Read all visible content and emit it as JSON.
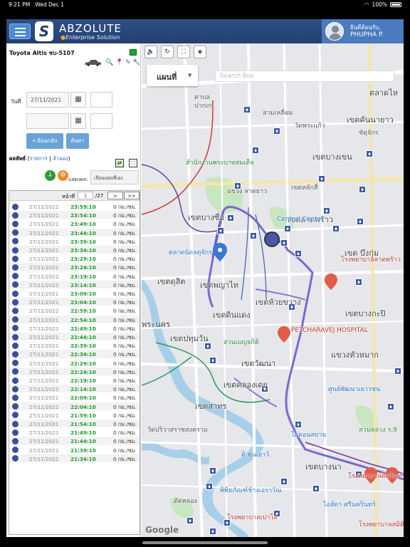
{
  "status_bar": {
    "time": "9:21 PM",
    "date": "Wed Dec 1",
    "battery": "100%"
  },
  "header": {
    "brand": "ABZOLUTE",
    "brand_sub": "Enterprise Solution",
    "greeting": "ยินดีต้อนรับ,",
    "user_name": "PHUPHA P."
  },
  "vehicle": {
    "name": "Toyota Altis ชบ-5107",
    "status_color": "#1aa830"
  },
  "filters": {
    "date_label": "วันที่",
    "date_from": "27/11/2021",
    "date_to": "",
    "back_button": "« ย้อนกลับ",
    "search_button": "ค้นหา"
  },
  "results": {
    "label": "ผลลัพธ์",
    "list_link": "รายการ",
    "separator": "|",
    "sim_link": "จำลอง",
    "show_label": "แสดงผล:",
    "show_select": "เลือนแผนที่เอง"
  },
  "pager": {
    "page_label": "หน้าที่",
    "page": "1",
    "total": "/27",
    "next": ">",
    "last": ">>"
  },
  "rows": [
    {
      "date": "27/11/2021",
      "time": "23:59:10",
      "speed": "0 กม./ชม."
    },
    {
      "date": "27/11/2021",
      "time": "23:54:10",
      "speed": "0 กม./ชม."
    },
    {
      "date": "27/11/2021",
      "time": "23:49:10",
      "speed": "0 กม./ชม."
    },
    {
      "date": "27/11/2021",
      "time": "23:44:10",
      "speed": "0 กม./ชม."
    },
    {
      "date": "27/11/2021",
      "time": "23:39:10",
      "speed": "0 กม./ชม."
    },
    {
      "date": "27/11/2021",
      "time": "23:34:10",
      "speed": "0 กม./ชม."
    },
    {
      "date": "27/11/2021",
      "time": "23:29:10",
      "speed": "0 กม./ชม."
    },
    {
      "date": "27/11/2021",
      "time": "23:24:10",
      "speed": "0 กม./ชม."
    },
    {
      "date": "27/11/2021",
      "time": "23:19:10",
      "speed": "0 กม./ชม."
    },
    {
      "date": "27/11/2021",
      "time": "23:14:10",
      "speed": "0 กม./ชม."
    },
    {
      "date": "27/11/2021",
      "time": "23:09:10",
      "speed": "0 กม./ชม."
    },
    {
      "date": "27/11/2021",
      "time": "23:04:10",
      "speed": "0 กม./ชม."
    },
    {
      "date": "27/11/2021",
      "time": "22:59:10",
      "speed": "0 กม./ชม."
    },
    {
      "date": "27/11/2021",
      "time": "22:54:10",
      "speed": "0 กม./ชม."
    },
    {
      "date": "27/11/2021",
      "time": "22:49:10",
      "speed": "0 กม./ชม."
    },
    {
      "date": "27/11/2021",
      "time": "22:44:10",
      "speed": "0 กม./ชม."
    },
    {
      "date": "27/11/2021",
      "time": "22:39:10",
      "speed": "0 กม./ชม."
    },
    {
      "date": "27/11/2021",
      "time": "22:34:10",
      "speed": "0 กม./ชม."
    },
    {
      "date": "27/11/2021",
      "time": "22:29:10",
      "speed": "0 กม./ชม."
    },
    {
      "date": "27/11/2021",
      "time": "22:24:10",
      "speed": "0 กม./ชม."
    },
    {
      "date": "27/11/2021",
      "time": "22:19:10",
      "speed": "0 กม./ชม."
    },
    {
      "date": "27/11/2021",
      "time": "22:14:10",
      "speed": "0 กม./ชม."
    },
    {
      "date": "27/11/2021",
      "time": "22:09:10",
      "speed": "0 กม./ชม."
    },
    {
      "date": "27/11/2021",
      "time": "22:04:10",
      "speed": "0 กม./ชม."
    },
    {
      "date": "27/11/2021",
      "time": "21:59:10",
      "speed": "0 กม./ชม."
    },
    {
      "date": "27/11/2021",
      "time": "21:54:10",
      "speed": "0 กม./ชม."
    },
    {
      "date": "27/11/2021",
      "time": "21:49:10",
      "speed": "0 กม./ชม."
    },
    {
      "date": "27/11/2021",
      "time": "21:44:10",
      "speed": "0 กม./ชม."
    },
    {
      "date": "27/11/2021",
      "time": "21:39:10",
      "speed": "0 กม./ชม."
    },
    {
      "date": "27/11/2021",
      "time": "21:34:10",
      "speed": "0 กม./ชม."
    }
  ],
  "map": {
    "type_label": "แผนที่",
    "search_placeholder": "Search Box",
    "attribution": "Google",
    "labels": {
      "l1": "ตาบล",
      "l2": "ปากเก",
      "l3": "สามเหลี่ยม",
      "l4": "ตลาดไห",
      "l5": "วัดพระแก้ว",
      "l6": "ชัตุจักร",
      "l7": "สำนักงานพระบาทสมเด็จ",
      "l8": "เขตบางเขน",
      "l9": "เขตบางซื่อ",
      "l10": "แขวง ลาดยาว",
      "l11": "เขตลาดพร้าว",
      "l12": "เขต บึงกุ่ม",
      "l13": "เขตหลักสี่",
      "l14": "ตลาดนัดจตุจักร",
      "l15": "เขตดุสิต",
      "l16": "เขตพญาไท",
      "l17": "เขตห้วยขวาง",
      "l18": "เขตบางกะปิ",
      "l19": "พระนคร",
      "l20": "เขตดินแดง",
      "l21": "PETCHARAVEJ HOSPITAL",
      "l22": "แขวงหัวหมาก",
      "l23": "เขตปทุมวัน",
      "l24": "สวนเบญจกิติ",
      "l25": "เขตวัฒนา",
      "l26": "เขตคลองเตย",
      "l27": "วัดปริวาสราชสงคราม",
      "l28": "เขตสาทร",
      "l29": "เขตบางนา",
      "l30": "ไอคอนสยาม",
      "l31": "ดัดหลอง",
      "l32": "โรงพยาบาลเปาโล",
      "l33": "พิพิธภัณฑ์ช้างเอราวัณ",
      "l34": "Central Center",
      "l35": "โรงพยาบาลลาดพร้าว",
      "l36": "สวนหลวง ร.9",
      "l37": "โรงพยาบาลสมิติเวช",
      "l38": "ไอส์ดา ศรีนครินทร์",
      "l39": "โรงพยาบาลศิครินทร์",
      "l40": "ศูนย์พัฒนาเยาวชน",
      "l41": "ดิ พุ่นเยาว์",
      "l42": "เขตคันนายาว"
    }
  }
}
